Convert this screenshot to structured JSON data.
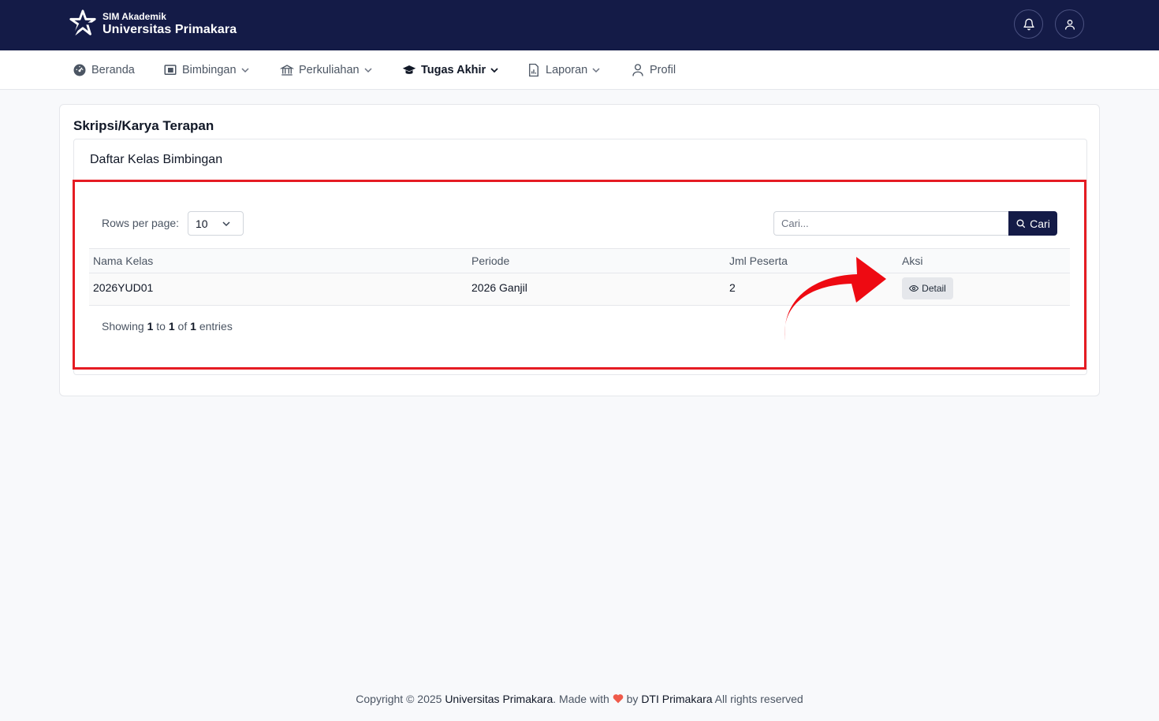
{
  "header": {
    "brand_small": "SIM Akademik",
    "brand_name": "Universitas Primakara",
    "icons": [
      "bell-icon",
      "user-icon"
    ]
  },
  "nav": {
    "items": [
      {
        "label": "Beranda",
        "icon": "dashboard-icon",
        "dropdown": false
      },
      {
        "label": "Bimbingan",
        "icon": "board-icon",
        "dropdown": true
      },
      {
        "label": "Perkuliahan",
        "icon": "building-icon",
        "dropdown": true
      },
      {
        "label": "Tugas Akhir",
        "icon": "graduation-cap-icon",
        "dropdown": true,
        "active": true
      },
      {
        "label": "Laporan",
        "icon": "report-icon",
        "dropdown": true
      },
      {
        "label": "Profil",
        "icon": "user-icon",
        "dropdown": false
      }
    ]
  },
  "page": {
    "title": "Skripsi/Karya Terapan",
    "card_title": "Daftar Kelas Bimbingan"
  },
  "table_controls": {
    "rows_label": "Rows per page:",
    "rows_value": "10",
    "search_placeholder": "Cari...",
    "search_button": "Cari"
  },
  "table": {
    "columns": [
      "Nama Kelas",
      "Periode",
      "Jml Peserta",
      "Aksi"
    ],
    "rows": [
      {
        "nama_kelas": "2026YUD01",
        "periode": "2026 Ganjil",
        "jml_peserta": "2",
        "aksi": "Detail"
      }
    ]
  },
  "pagination": {
    "showing": "Showing",
    "from": "1",
    "to_word": "to",
    "to": "1",
    "of_word": "of",
    "total": "1",
    "entries": "entries"
  },
  "footer": {
    "copyright": "Copyright © 2025",
    "org": "Universitas Primakara",
    "made_with": ". Made with",
    "by": "by",
    "team": "DTI Primakara",
    "rights": "All rights reserved"
  },
  "colors": {
    "primary": "#141b47",
    "highlight": "#e51c23",
    "heart": "#ef5a4a"
  }
}
